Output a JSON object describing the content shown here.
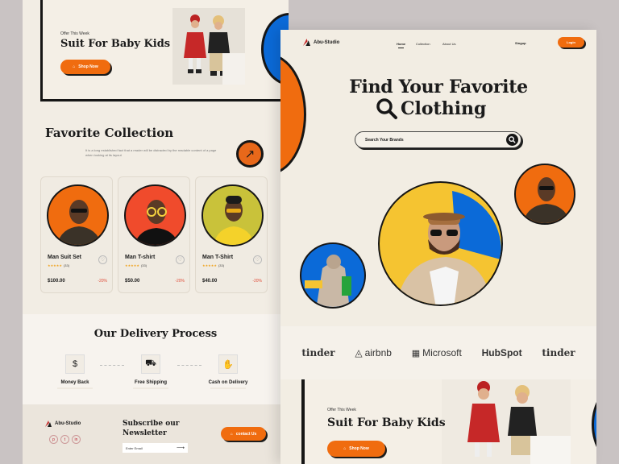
{
  "left": {
    "offer": {
      "tag": "Offer This Week",
      "title": "Suit For Baby Kids",
      "button": "Shop Now"
    },
    "favorite": {
      "title": "Favorite Collection",
      "description": "It is a long established fact that a reader will be distracted by the readable content of a page when looking at its layout"
    },
    "products": [
      {
        "name": "Man Suit Set",
        "reviews": "(33)",
        "price": "$100.00",
        "discount": "-20%",
        "bg": "#f06c0f"
      },
      {
        "name": "Man T-shirt",
        "reviews": "(33)",
        "price": "$50.00",
        "discount": "-20%",
        "bg": "#f04b2c"
      },
      {
        "name": "Man T-Shirt",
        "reviews": "(33)",
        "price": "$40.00",
        "discount": "-20%",
        "bg": "#c9c23a"
      }
    ],
    "delivery": {
      "title": "Our Delivery Process",
      "steps": [
        {
          "label": "Money Back",
          "icon": "money-icon"
        },
        {
          "label": "Free Shipping",
          "icon": "truck-icon"
        },
        {
          "label": "Cash on Delivery",
          "icon": "cash-icon"
        }
      ]
    },
    "footer": {
      "brand": "Abu-Studio",
      "subscribe_title": "Subscribe our Newsletter",
      "email_placeholder": "Enter Email",
      "contact_button": "contact Us",
      "socials": [
        "p",
        "t",
        "in"
      ]
    }
  },
  "right": {
    "nav": {
      "brand": "Abu-Studio",
      "links": [
        "Home",
        "Collection",
        "About Us"
      ],
      "signup": "Singup",
      "login": "Login"
    },
    "hero": {
      "line1": "Find Your Favorite",
      "line2": "Clothing"
    },
    "search": {
      "placeholder": "Search Your Brands"
    },
    "brands": [
      "tinder",
      "airbnb",
      "Microsoft",
      "HubSpot",
      "tinder"
    ],
    "offer": {
      "tag": "Offer This Week",
      "title": "Suit For Baby Kids",
      "button": "Shop Now"
    }
  },
  "colors": {
    "accent": "#f06c0f",
    "blue": "#0b6ad8",
    "yellow": "#f5c431",
    "dark": "#161616",
    "bg": "#f2ede3"
  }
}
